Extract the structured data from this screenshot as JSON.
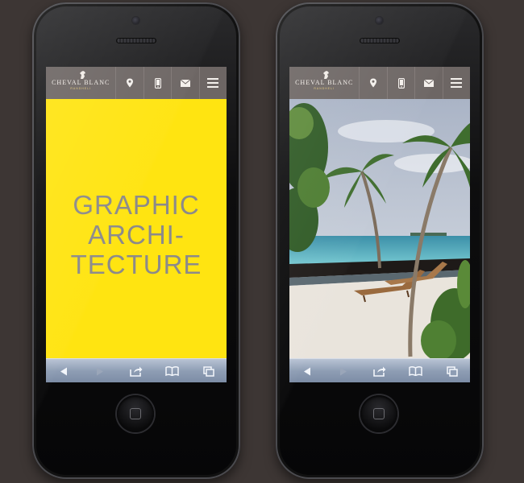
{
  "brand": {
    "logo_main": "CHEVAL BLANC",
    "logo_sub": "RANDHELI",
    "gold": "#e2c77a"
  },
  "nav": {
    "icons": [
      "location-pin-icon",
      "mobile-phone-icon",
      "envelope-icon",
      "hamburger-menu-icon"
    ],
    "bar_color": "#6d6664"
  },
  "left_screen": {
    "background": "#ffe411",
    "headline": [
      "GRAPHIC",
      "ARCHI-",
      "TECTURE"
    ]
  },
  "right_screen": {
    "image": "beach-with-palm-trees-and-loungers"
  },
  "browser_toolbar": {
    "icons": [
      "back-arrow-icon",
      "forward-arrow-icon",
      "share-icon",
      "bookmarks-icon",
      "tabs-icon"
    ]
  },
  "colors": {
    "background": "#3d3634"
  }
}
